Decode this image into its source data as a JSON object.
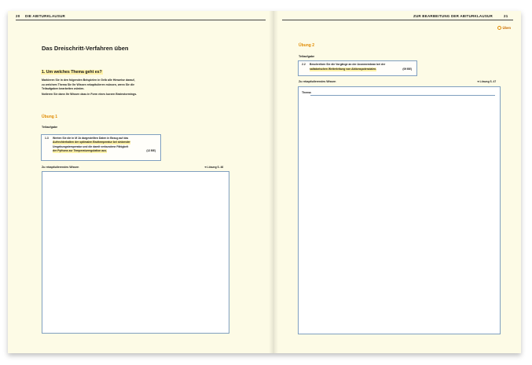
{
  "header": {
    "left_page_number": "20",
    "left_title": "DIE ABITURKLAUSUR",
    "right_title": "ZUR BEARBEITUNG DER ABITURKLAUSUR",
    "right_page_number": "21"
  },
  "uben_label": "Üben",
  "left": {
    "title": "Das Dreischritt-Verfahren üben",
    "section_heading": "1. Um welches Thema geht es?",
    "intro_lines": [
      "Markieren Sie in den folgenden Beispielen in Gelb alle Hinweise darauf,",
      "zu welchem Thema Sie Ihr Wissen rekapitulieren müssen, wenn Sie die",
      "Teilaufgaben bearbeiten würden."
    ],
    "intro_line2": "Notieren Sie dann Ihr Wissen dazu in Form eines kurzen Brainstormings.",
    "exercise_heading": "Übung 1",
    "subtask_label": "Teilaufgabe",
    "task": {
      "number": "1.3",
      "lines": [
        "Werten Sie die in M 1b dargestellten Daten in Bezug auf das",
        "Aufrechterhalten der optimalen Bruttemperatur bei sinkender",
        "Umgebungstemperatur und die damit verbundene Fähigkeit",
        "der Pythons zur Temperaturregulation aus."
      ],
      "points": "(12 BE)"
    },
    "knowledge_label": "Zu rekapitulierendes Wissen",
    "solution_ref": "➔ Lösung S. 46"
  },
  "right": {
    "exercise_heading": "Übung 2",
    "subtask_label": "Teilaufgabe",
    "task": {
      "number": "2.2",
      "lines": [
        "Beschreiben Sie die Vorgänge an der Axonmembran bei der",
        "saltatorischen Weiterleitung von Aktionspotenzialen."
      ],
      "points": "(09 BE)"
    },
    "knowledge_label": "Zu rekapitulierendes Wissen",
    "solution_ref": "➔ Lösung S. 47",
    "thema_label": "Thema:"
  }
}
